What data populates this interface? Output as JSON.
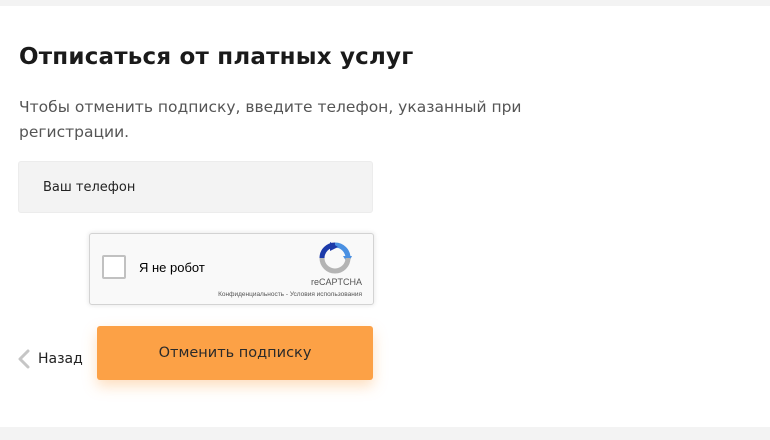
{
  "page": {
    "title": "Отписаться от платных услуг",
    "description": "Чтобы отменить подписку, введите телефон, указанный при регистрации."
  },
  "form": {
    "phone": {
      "value": "",
      "placeholder": "Ваш телефон"
    },
    "captcha": {
      "checkbox_label": "Я не робот",
      "brand": "reCAPTCHA",
      "privacy_link": "Конфиденциальность",
      "separator": " - ",
      "terms_link": "Условия использования",
      "logo_icon": "recaptcha-logo-icon",
      "checked": false
    },
    "back": {
      "label": "Назад",
      "icon": "chevron-left-icon"
    },
    "submit": {
      "label": "Отменить подписку"
    }
  },
  "colors": {
    "accent": "#fca146",
    "background": "#f3f3f3",
    "card": "#ffffff",
    "text": "#1a1a1a",
    "muted_text": "#555555"
  }
}
